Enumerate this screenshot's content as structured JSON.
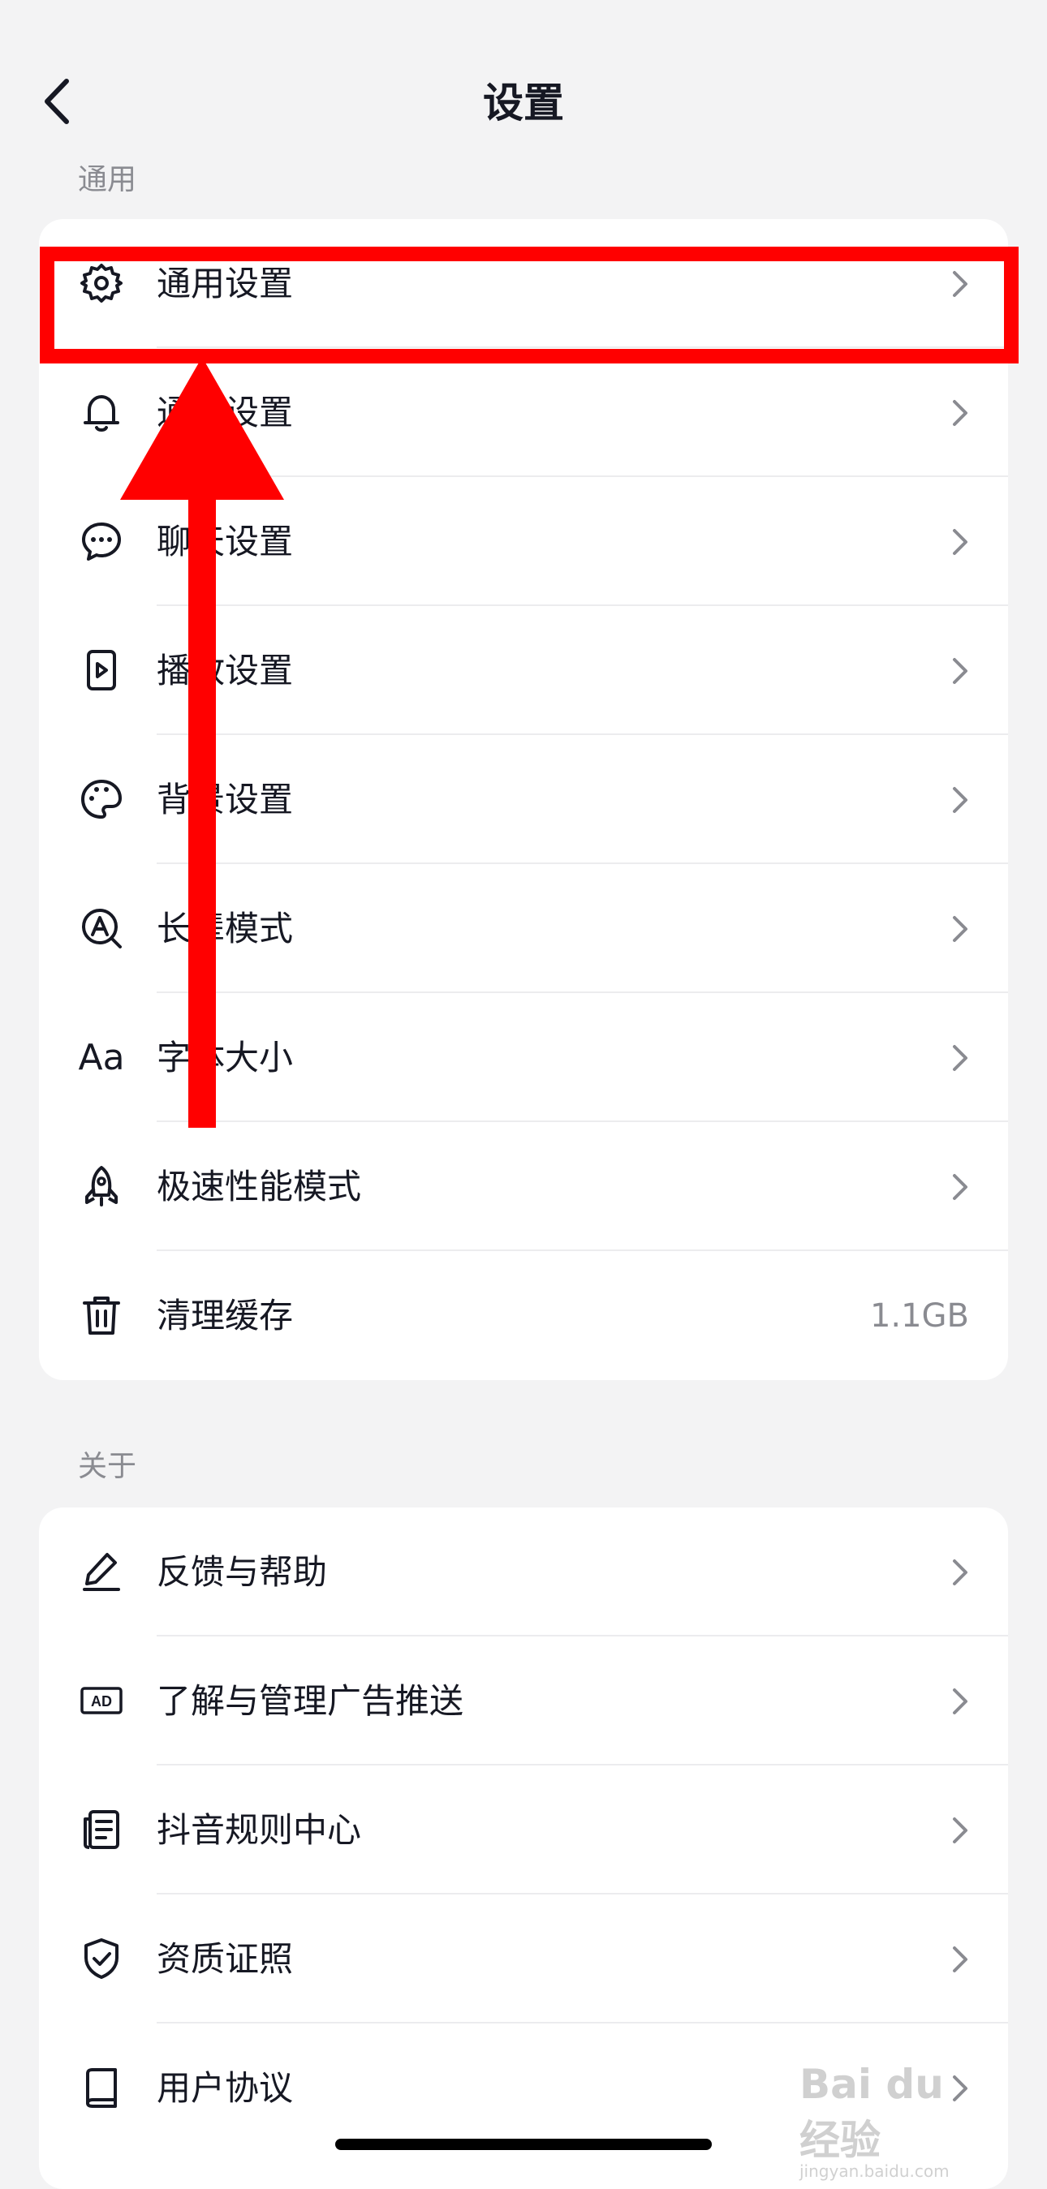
{
  "header": {
    "title": "设置"
  },
  "sections": [
    {
      "title": "通用",
      "items": [
        {
          "label": "通用设置",
          "icon": "gear-icon"
        },
        {
          "label": "通知设置",
          "icon": "bell-icon"
        },
        {
          "label": "聊天设置",
          "icon": "chat-bubble-icon"
        },
        {
          "label": "播放设置",
          "icon": "play-icon"
        },
        {
          "label": "背景设置",
          "icon": "palette-icon"
        },
        {
          "label": "长辈模式",
          "icon": "magnify-a-icon"
        },
        {
          "label": "字体大小",
          "icon": "font-size-icon",
          "glyph": "Aa"
        },
        {
          "label": "极速性能模式",
          "icon": "rocket-icon"
        },
        {
          "label": "清理缓存",
          "icon": "trash-icon",
          "value": "1.1GB"
        }
      ]
    },
    {
      "title": "关于",
      "items": [
        {
          "label": "反馈与帮助",
          "icon": "edit-pen-icon"
        },
        {
          "label": "了解与管理广告推送",
          "icon": "ad-icon",
          "glyph": "AD"
        },
        {
          "label": "抖音规则中心",
          "icon": "document-icon"
        },
        {
          "label": "资质证照",
          "icon": "shield-check-icon"
        },
        {
          "label": "用户协议",
          "icon": "book-icon"
        }
      ]
    }
  ],
  "watermark": {
    "text": "Bai du 经验",
    "sub": "jingyan.baidu.com"
  },
  "colors": {
    "annotation": "#ff0000",
    "background": "#f3f3f4",
    "card": "#ffffff",
    "secondary_text": "#8a8b91"
  }
}
